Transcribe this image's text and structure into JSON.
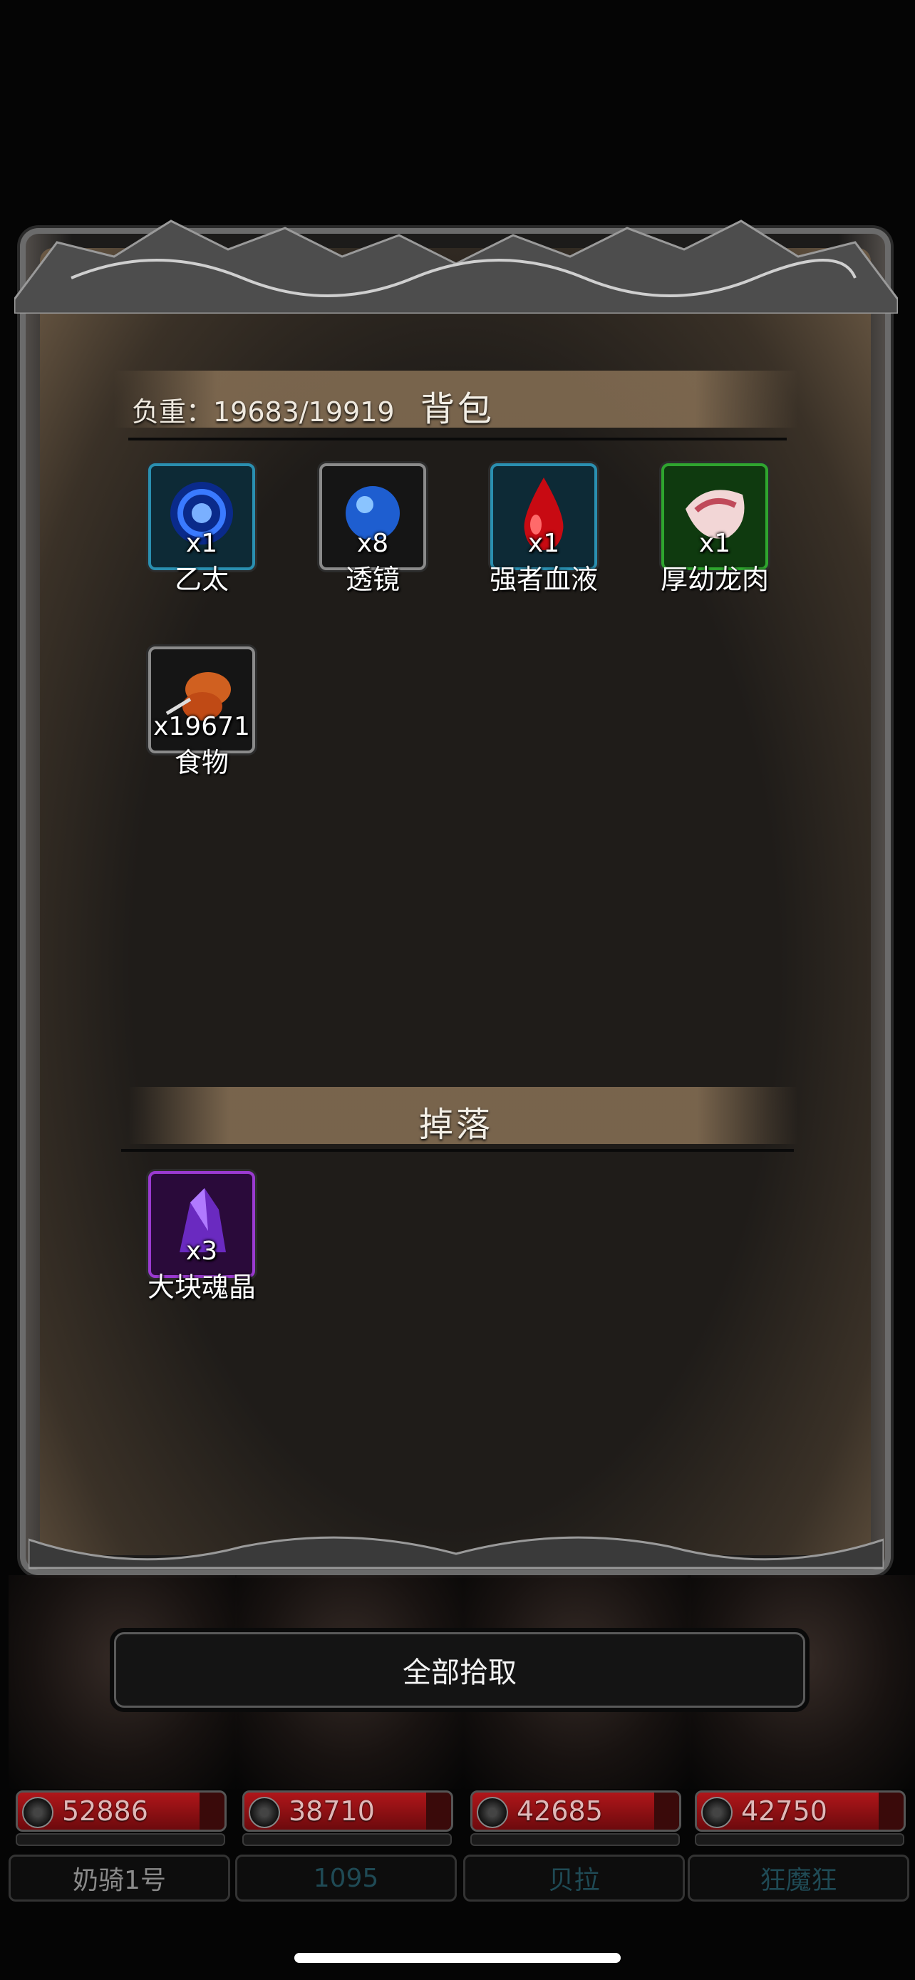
{
  "bag": {
    "title": "背包",
    "weight_label": "负重：19683/19919",
    "items": [
      {
        "name": "乙太",
        "qty": "x1",
        "icon": "blue-vortex-icon",
        "border": "#2a8fb0"
      },
      {
        "name": "透镜",
        "qty": "x8",
        "icon": "blue-orb-icon",
        "border": "#7a7a7a"
      },
      {
        "name": "强者血液",
        "qty": "x1",
        "icon": "blood-drop-icon",
        "border": "#2a8fb0"
      },
      {
        "name": "厚幼龙肉",
        "qty": "x1",
        "icon": "meat-icon",
        "border": "#2fa52f"
      },
      {
        "name": "食物",
        "qty": "x19671",
        "icon": "roast-meat-icon",
        "border": "#7a7a7a"
      }
    ]
  },
  "drops": {
    "title": "掉落",
    "items": [
      {
        "name": "大块魂晶",
        "qty": "x3",
        "icon": "purple-crystal-icon",
        "border": "#9a3ad0"
      }
    ]
  },
  "actions": {
    "pickup_all": "全部拾取"
  },
  "party": [
    {
      "hp": "52886",
      "name": "奶骑1号",
      "name_color": "#8a8a8a"
    },
    {
      "hp": "38710",
      "name": "1095",
      "name_color": "#1f4a55"
    },
    {
      "hp": "42685",
      "name": "贝拉",
      "name_color": "#1f4a55"
    },
    {
      "hp": "42750",
      "name": "狂魔狂",
      "name_color": "#1f4a55"
    }
  ]
}
